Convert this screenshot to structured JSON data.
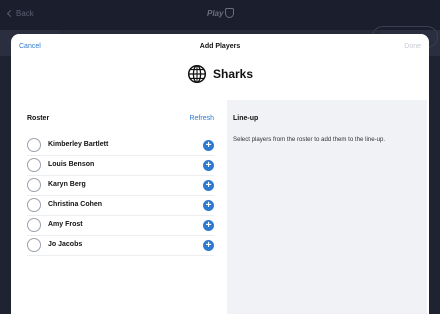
{
  "background": {
    "back_label": "Back",
    "logo_label": "Play"
  },
  "modal": {
    "cancel_label": "Cancel",
    "title": "Add Players",
    "done_label": "Done",
    "team_icon": "globe-icon",
    "team_name": "Sharks"
  },
  "roster": {
    "heading": "Roster",
    "refresh_label": "Refresh",
    "players": [
      {
        "name": "Kimberley Bartlett"
      },
      {
        "name": "Louis Benson"
      },
      {
        "name": "Karyn Berg"
      },
      {
        "name": "Christina Cohen"
      },
      {
        "name": "Amy Frost"
      },
      {
        "name": "Jo Jacobs"
      }
    ],
    "add_icon": "plus-circle-icon",
    "add_glyph": "+"
  },
  "lineup": {
    "heading": "Line-up",
    "empty_text": "Select players from the roster to add them to the line-up."
  },
  "colors": {
    "accent": "#2e7ad1",
    "panel_bg": "#f0f2f6",
    "backdrop": "#1f2231"
  }
}
